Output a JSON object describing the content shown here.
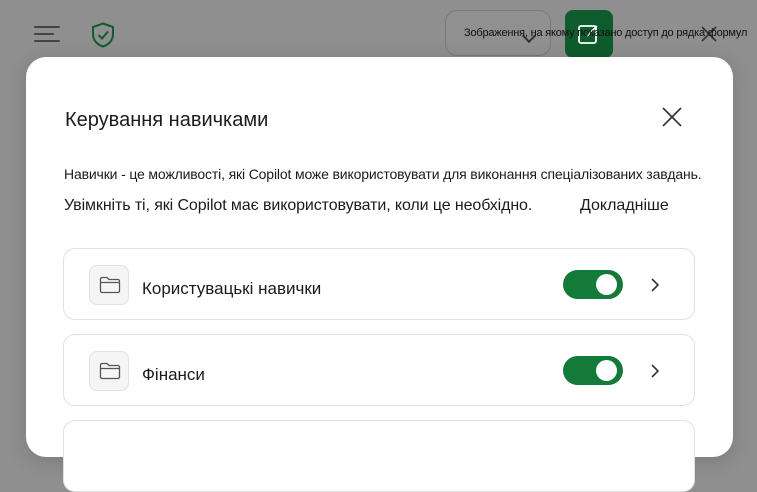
{
  "app_bar": {
    "menu_icon": "hamburger-menu-icon",
    "shield_icon": "shield-check-icon",
    "compose_icon": "edit-square-icon",
    "close_icon": "close-icon",
    "tooltip": "Зображення, на якому показано доступ до рядка формул"
  },
  "modal": {
    "title": "Керування навичками",
    "description_line1": "Навички - це можливості, які Copilot може використовувати для виконання спеціалізованих завдань.",
    "description_line2": "Увімкніть ті, які Copilot має використовувати, коли це необхідно.",
    "learn_more": "Докладніше",
    "skills": [
      {
        "label": "Користувацькі навички",
        "enabled": true,
        "icon": "folder-icon"
      },
      {
        "label": "Фінанси",
        "enabled": true,
        "icon": "folder-icon"
      },
      {
        "label": "",
        "enabled": null,
        "icon": ""
      }
    ]
  },
  "colors": {
    "overlay": "#8f8f8f",
    "toggle_on": "#137a3a",
    "accent_dark_green": "#0e5c2e",
    "modal_bg": "#ffffff"
  }
}
